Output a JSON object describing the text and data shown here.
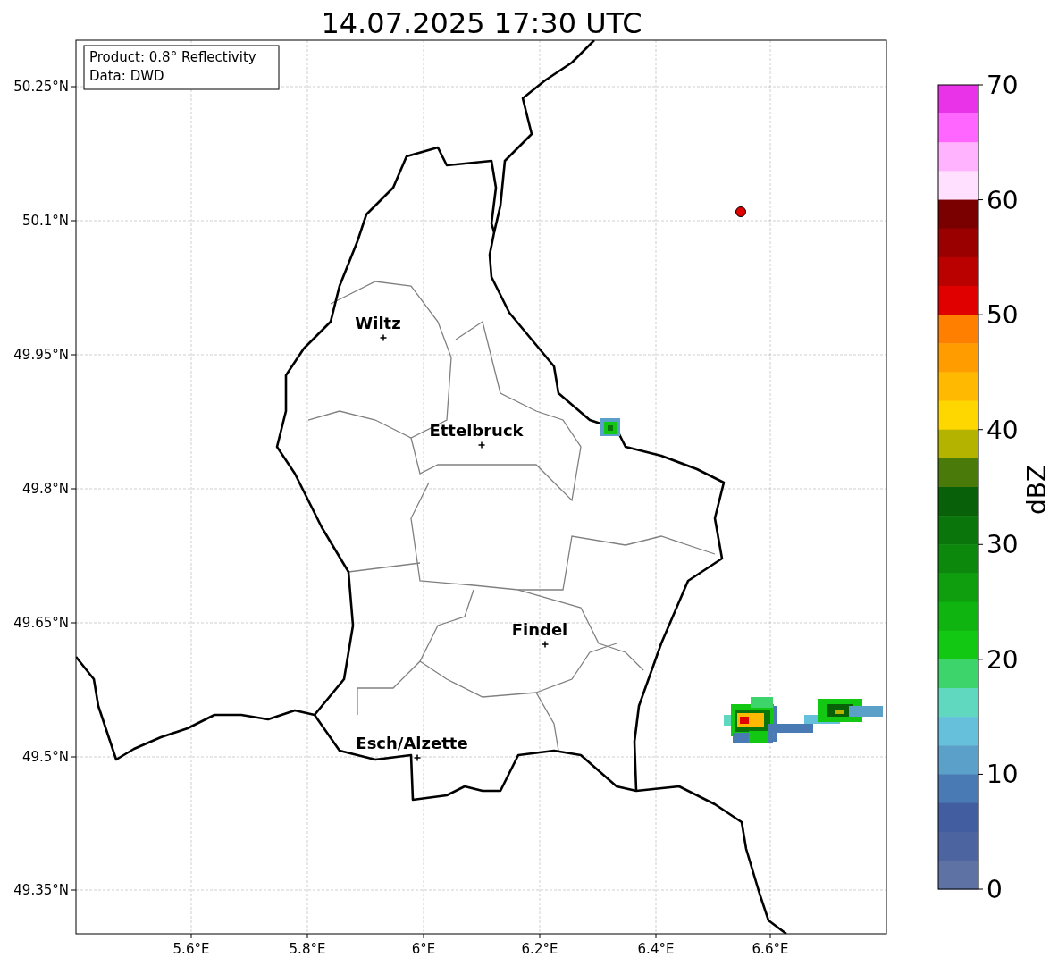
{
  "title": "14.07.2025 17:30 UTC",
  "info_box": [
    "Product: 0.8° Reflectivity",
    "Data: DWD"
  ],
  "xticks": [
    "5.6°E",
    "5.8°E",
    "6°E",
    "6.2°E",
    "6.4°E",
    "6.6°E"
  ],
  "yticks": [
    "50.25°N",
    "50.1°N",
    "49.95°N",
    "49.8°N",
    "49.65°N",
    "49.5°N",
    "49.35°N"
  ],
  "cities": [
    {
      "name": "Wiltz"
    },
    {
      "name": "Ettelbruck"
    },
    {
      "name": "Findel"
    },
    {
      "name": "Esch/Alzette"
    }
  ],
  "colorbar": {
    "label": "dBZ",
    "ticks": [
      "70",
      "60",
      "50",
      "40",
      "30",
      "20",
      "10",
      "0"
    ],
    "colors": [
      {
        "color": "#e833e8"
      },
      {
        "color": "#ff66ff"
      },
      {
        "color": "#ffb3ff"
      },
      {
        "color": "#ffe0ff"
      },
      {
        "color": "#7a0000"
      },
      {
        "color": "#9b0000"
      },
      {
        "color": "#bb0000"
      },
      {
        "color": "#e00000"
      },
      {
        "color": "#ff7f00"
      },
      {
        "color": "#ff9c00"
      },
      {
        "color": "#ffb900"
      },
      {
        "color": "#ffd700"
      },
      {
        "color": "#b3b300"
      },
      {
        "color": "#4a7a0a"
      },
      {
        "color": "#086008"
      },
      {
        "color": "#0a750a"
      },
      {
        "color": "#0c880c"
      },
      {
        "color": "#0e9e0e"
      },
      {
        "color": "#10b410"
      },
      {
        "color": "#12c812"
      },
      {
        "color": "#3dd46c"
      },
      {
        "color": "#60d8c0"
      },
      {
        "color": "#66c0dc"
      },
      {
        "color": "#5aa0c8"
      },
      {
        "color": "#4a7ab4"
      },
      {
        "color": "#425ea0"
      },
      {
        "color": "#4c64a0"
      },
      {
        "color": "#5e72a4"
      }
    ]
  }
}
